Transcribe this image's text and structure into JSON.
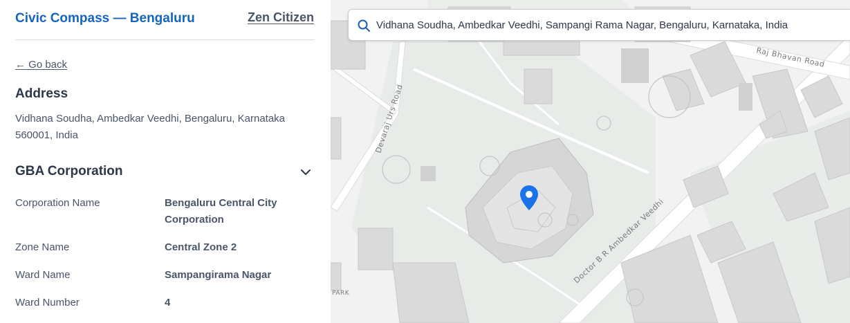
{
  "header": {
    "title": "Civic Compass — Bengaluru",
    "zen_link": "Zen Citizen"
  },
  "nav": {
    "go_back": "← Go back"
  },
  "address": {
    "heading": "Address",
    "text": "Vidhana Soudha, Ambedkar Veedhi, Bengaluru, Karnataka 560001, India"
  },
  "corporation": {
    "heading": "GBA Corporation",
    "rows": [
      {
        "label": "Corporation Name",
        "value": "Bengaluru Central City Corporation"
      },
      {
        "label": "Zone Name",
        "value": "Central Zone 2"
      },
      {
        "label": "Ward Name",
        "value": "Sampangirama Nagar"
      },
      {
        "label": "Ward Number",
        "value": "4"
      }
    ]
  },
  "map": {
    "search_value": "Vidhana Soudha, Ambedkar Veedhi, Sampangi Rama Nagar, Bengaluru, Karnataka, India",
    "road_labels": {
      "raj_bhavan": "Raj Bhavan Road",
      "devaraj_urs": "Devaraj Urs Road",
      "ambedkar": "Doctor B R Ambedkar Veedhi",
      "park": "PARK"
    },
    "marker_color": "#1a73e8",
    "marker_icon": "map-pin-icon"
  }
}
